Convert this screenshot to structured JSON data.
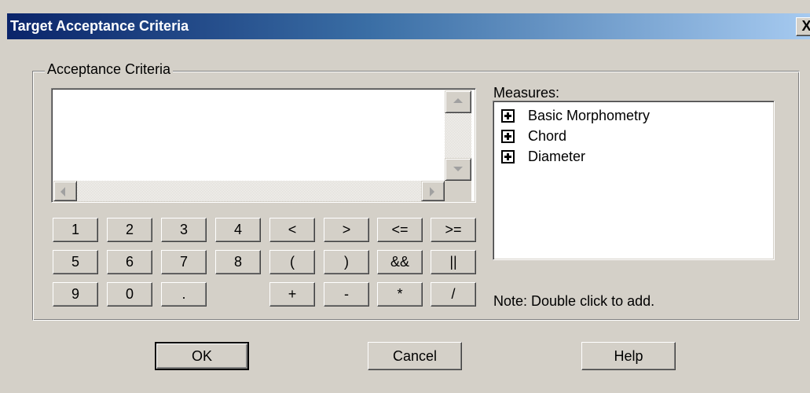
{
  "window": {
    "title": "Target Acceptance Criteria",
    "close_label": "X"
  },
  "criteria_group": {
    "legend": "Acceptance Criteria",
    "expression_value": ""
  },
  "keypad": {
    "rows": [
      [
        "1",
        "2",
        "3",
        "4",
        "<",
        ">",
        "<=",
        ">="
      ],
      [
        "5",
        "6",
        "7",
        "8",
        "(",
        ")",
        "&&",
        "||"
      ],
      [
        "9",
        "0",
        ".",
        "",
        "+",
        "-",
        "*",
        "/"
      ]
    ]
  },
  "measures": {
    "label": "Measures:",
    "items": [
      {
        "label": "Basic Morphometry",
        "icon": "plus-box-icon",
        "expanded": false
      },
      {
        "label": "Chord",
        "icon": "plus-box-icon",
        "expanded": false
      },
      {
        "label": "Diameter",
        "icon": "plus-box-icon",
        "expanded": false
      }
    ],
    "note": "Note:  Double click to add."
  },
  "buttons": {
    "ok": "OK",
    "cancel": "Cancel",
    "help": "Help"
  }
}
